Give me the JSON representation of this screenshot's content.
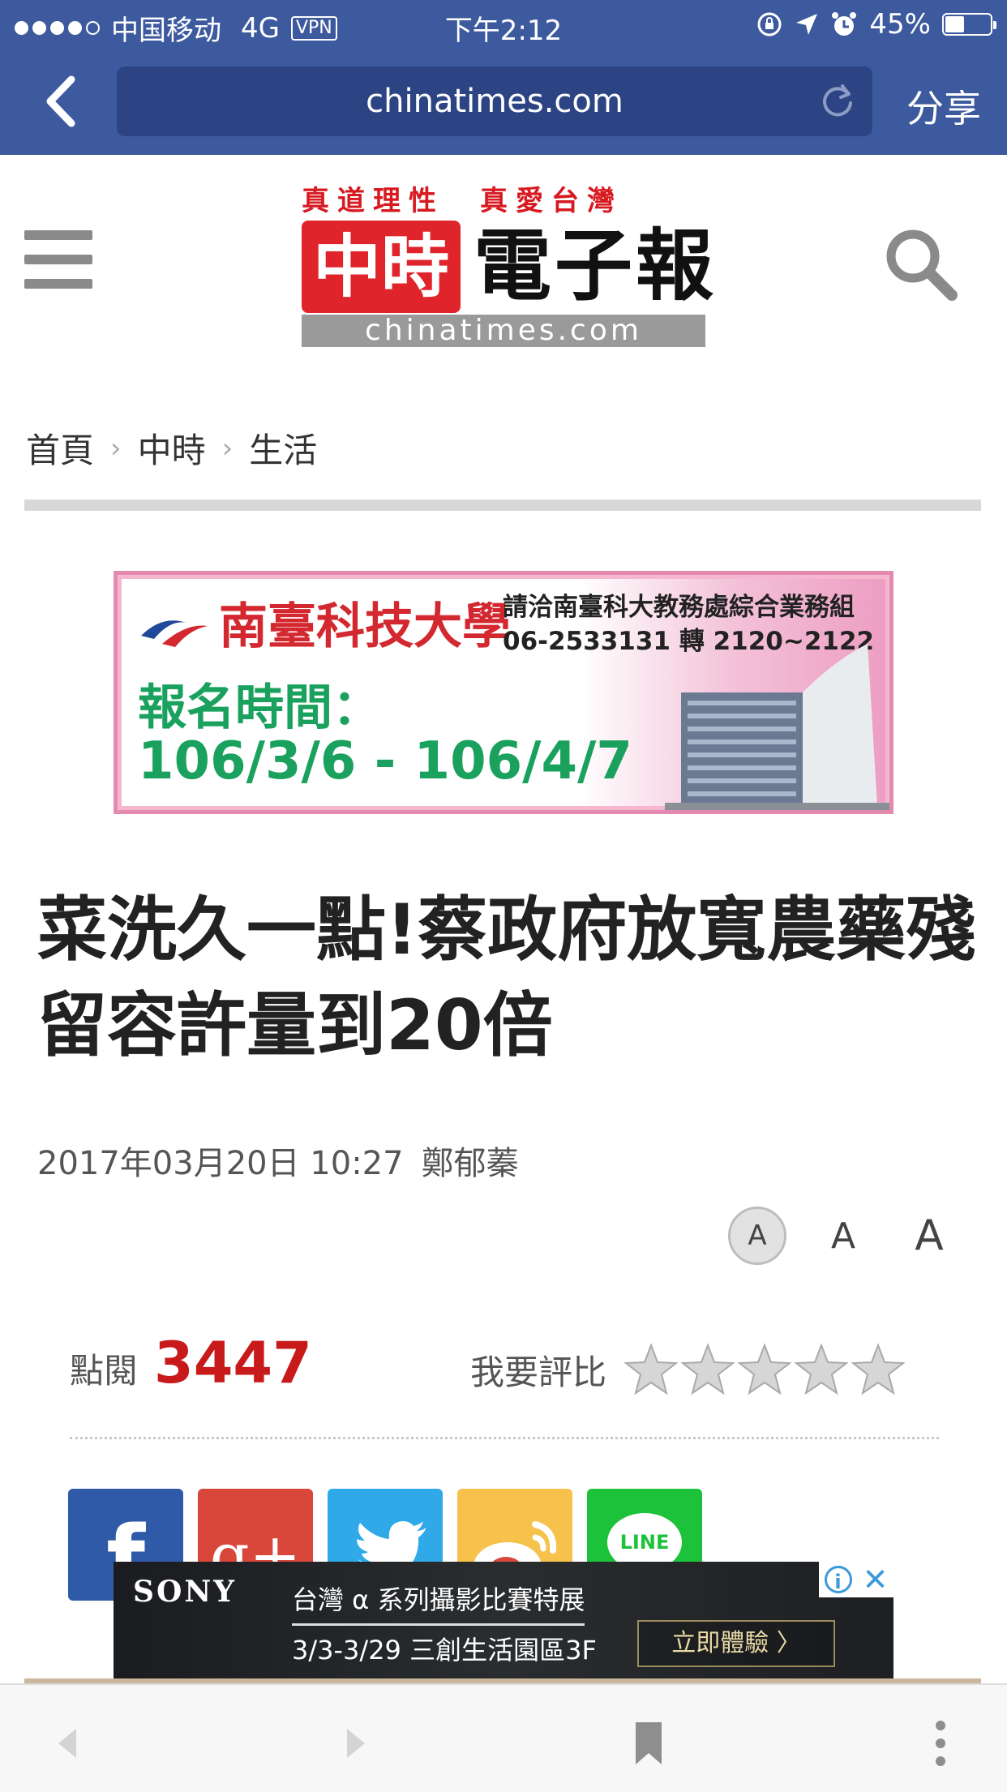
{
  "status_bar": {
    "carrier": "中国移动",
    "network": "4G",
    "vpn": "VPN",
    "time": "下午2:12",
    "battery_percent": "45%",
    "battery_level": 0.45
  },
  "browser": {
    "url": "chinatimes.com",
    "share_label": "分享"
  },
  "site": {
    "slogan": "真道理性　真愛台灣",
    "logo_red": "中時",
    "logo_black": "電子報",
    "logo_domain": "chinatimes.com"
  },
  "breadcrumb": {
    "items": [
      "首頁",
      "中時",
      "生活"
    ],
    "separator": "›"
  },
  "ad_banner": {
    "school": "南臺科技大學",
    "contact_line1": "請洽南臺科大教務處綜合業務組",
    "contact_line2": "06-2533131 轉 2120~2122",
    "registration_label": "報名時間：",
    "dates": "106/3/6  -  106/4/7"
  },
  "article": {
    "headline": "菜洗久一點!蔡政府放寬農藥殘留容許量到20倍",
    "datetime": "2017年03月20日 10:27",
    "author": "鄭郁蓁",
    "font_sizes": [
      "A",
      "A",
      "A"
    ],
    "views_label": "點閱",
    "views_count": "3447",
    "rating_label": "我要評比",
    "rating_stars": 5
  },
  "socials": {
    "facebook": "f",
    "googleplus": "g+",
    "line": "LINE"
  },
  "sony_ad": {
    "brand": "SONY",
    "title": "台灣 α 系列攝影比賽特展",
    "subtitle": "3/3-3/29 三創生活園區3F",
    "cta": "立即體驗 〉"
  },
  "colors": {
    "header_blue": "#3d5a9e",
    "accent_red": "#c81a1a"
  }
}
